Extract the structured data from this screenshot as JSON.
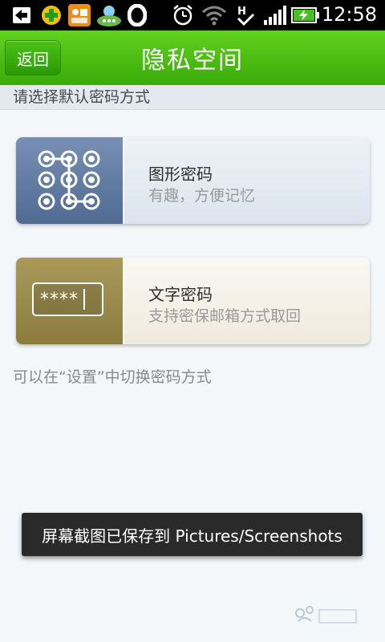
{
  "status_bar": {
    "time": "12:58",
    "icons": [
      "back-arrow-icon",
      "plus-circle-icon",
      "app-icon",
      "chat-icon",
      "opera-icon",
      "alarm-icon",
      "wifi-icon",
      "h-signal-icon",
      "signal-bars-icon",
      "battery-charging-icon"
    ]
  },
  "header": {
    "back_label": "返回",
    "title": "隐私空间"
  },
  "section": {
    "label": "请选择默认密码方式"
  },
  "options": [
    {
      "title": "图形密码",
      "subtitle": "有趣，方便记忆",
      "icon": "pattern-lock-icon"
    },
    {
      "title": "文字密码",
      "subtitle": "支持密保邮箱方式取回",
      "icon": "password-field-icon",
      "mask": "****"
    }
  ],
  "hint": "可以在“设置”中切换密码方式",
  "toast": "屏幕截图已保存到 Pictures/Screenshots",
  "colors": {
    "header_green": "#4cc214",
    "pattern_card": "#516a92",
    "text_card": "#8b7b3e"
  }
}
